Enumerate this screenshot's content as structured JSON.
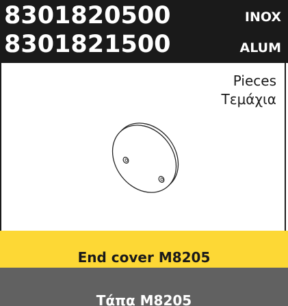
{
  "product": {
    "codes": [
      {
        "code": "8301820500",
        "material": "INOX"
      },
      {
        "code": "8301821500",
        "material": "ALUM"
      }
    ],
    "pieces_label_en": "Pieces",
    "pieces_label_el": "Τεμάχια",
    "image_icon": "end-cover-plate-illustration",
    "name_en": "End cover M8205",
    "name_el": "Τάπα M8205"
  },
  "colors": {
    "header_bg": "#1a1a1a",
    "accent_yellow": "#fdd835",
    "footer_grey": "#616161"
  }
}
